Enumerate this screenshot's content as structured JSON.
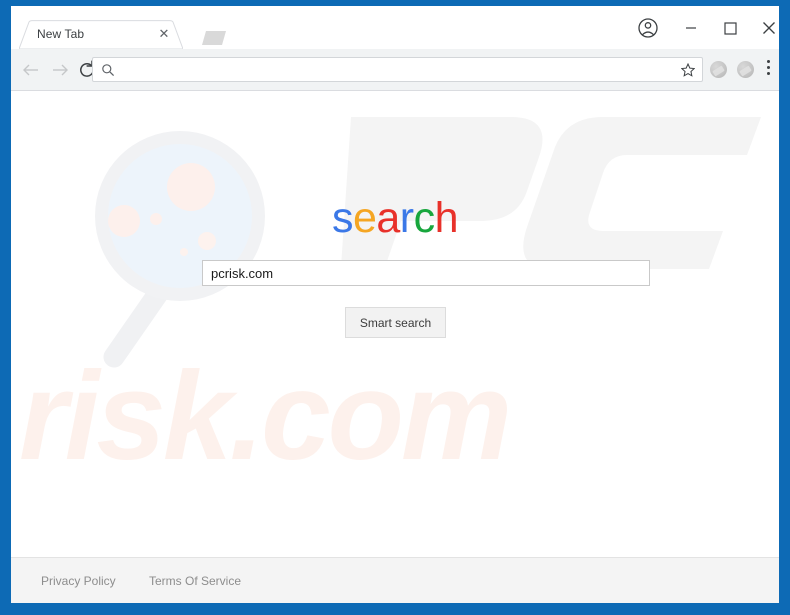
{
  "window": {
    "frame_color": "#0d6ab5",
    "controls": {
      "profile_icon": "profile-icon",
      "minimize_label": "–",
      "maximize_label": "□",
      "close_label": "✕"
    }
  },
  "browser": {
    "tabs": [
      {
        "title": "New Tab",
        "close_label": "✕"
      }
    ],
    "new_tab_button_name": "new-tab-button",
    "toolbar": {
      "back_icon": "arrow-left-icon",
      "forward_icon": "arrow-right-icon",
      "reload_icon": "reload-icon",
      "omnibox": {
        "value": "",
        "placeholder": "",
        "search_icon": "search-icon",
        "bookmark_icon": "star-icon"
      },
      "extensions": [
        "extension-icon-1",
        "extension-icon-2"
      ],
      "menu_icon": "kebab-menu-icon"
    }
  },
  "page": {
    "logo": {
      "letters": [
        {
          "char": "s",
          "color": "#3b78e7"
        },
        {
          "char": "e",
          "color": "#f5a623"
        },
        {
          "char": "a",
          "color": "#e8312a"
        },
        {
          "char": "r",
          "color": "#3b78e7"
        },
        {
          "char": "c",
          "color": "#18a63d"
        },
        {
          "char": "h",
          "color": "#e8312a"
        }
      ],
      "text": "search"
    },
    "search": {
      "value": "pcrisk.com",
      "placeholder": "",
      "button_label": "Smart search"
    },
    "watermarks": {
      "magnifier": "magnifying-glass-watermark",
      "pc": "PC",
      "risk": "risk.com"
    },
    "footer": {
      "privacy_label": "Privacy Policy",
      "terms_label": "Terms Of Service"
    }
  }
}
